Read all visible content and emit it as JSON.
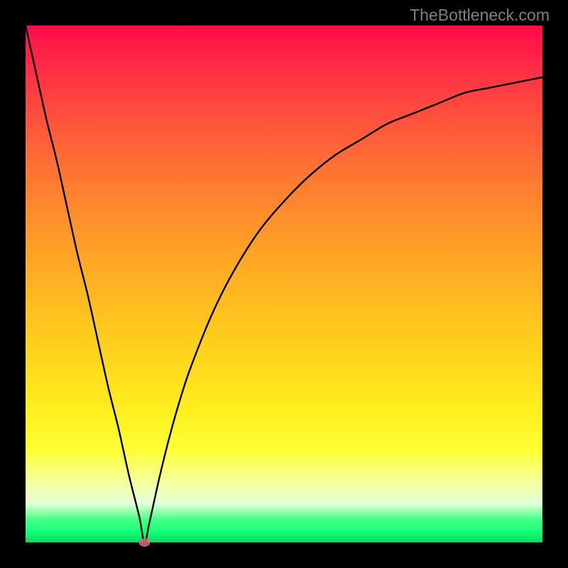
{
  "watermark": "TheBottleneck.com",
  "colors": {
    "border": "#000000",
    "curve": "#000000",
    "min_marker": "#d96b77",
    "gradient_top": "#ff0b4b",
    "gradient_bottom": "#00db61"
  },
  "chart_data": {
    "type": "line",
    "title": "",
    "xlabel": "",
    "ylabel": "",
    "xlim": [
      0,
      100
    ],
    "ylim": [
      0,
      100
    ],
    "x": [
      0,
      2,
      4,
      6,
      8,
      10,
      12,
      14,
      16,
      18,
      20,
      22,
      23,
      24,
      26,
      28,
      30,
      32,
      36,
      40,
      45,
      50,
      55,
      60,
      65,
      70,
      75,
      80,
      85,
      90,
      95,
      100
    ],
    "y": [
      100,
      91,
      82,
      74,
      65,
      56,
      48,
      39,
      30,
      22,
      13,
      5,
      0,
      4,
      13,
      21,
      28,
      34,
      44,
      52,
      60,
      66,
      71,
      75,
      78,
      81,
      83,
      85,
      87,
      88,
      89,
      90
    ],
    "min_point": {
      "x": 23,
      "y": 0
    },
    "annotations": []
  }
}
